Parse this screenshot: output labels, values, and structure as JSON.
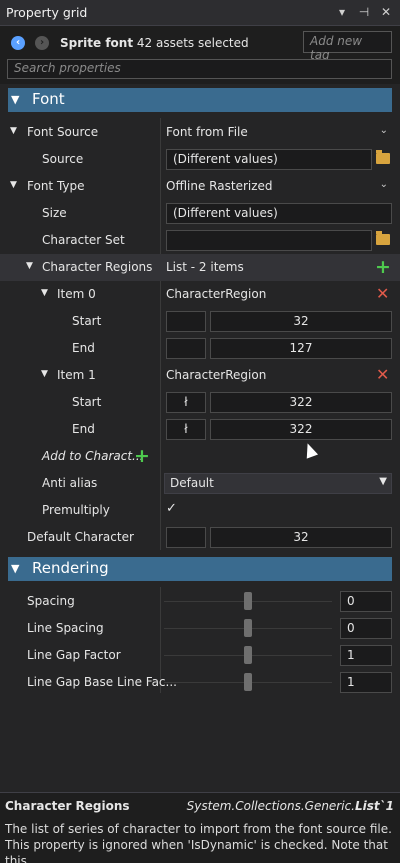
{
  "window": {
    "title": "Property grid",
    "btn_menu": "▾",
    "btn_pin": "⊣",
    "btn_close": "✕"
  },
  "header": {
    "asset_type": "Sprite font",
    "asset_count": "42 assets selected",
    "tag_placeholder": "Add new tag",
    "search_placeholder": "Search properties"
  },
  "categories": {
    "font": "Font",
    "rendering": "Rendering"
  },
  "font": {
    "font_source": {
      "label": "Font Source",
      "value": "Font from File"
    },
    "source": {
      "label": "Source",
      "value": "(Different values)"
    },
    "font_type": {
      "label": "Font Type",
      "value": "Offline Rasterized"
    },
    "size": {
      "label": "Size",
      "value": "(Different values)"
    },
    "character_set": {
      "label": "Character Set",
      "value": ""
    },
    "character_regions": {
      "label": "Character Regions",
      "value": "List - 2 items"
    },
    "items": [
      {
        "label": "Item 0",
        "type": "CharacterRegion",
        "start": {
          "label": "Start",
          "char": "",
          "value": "32"
        },
        "end": {
          "label": "End",
          "char": "",
          "value": "127"
        }
      },
      {
        "label": "Item 1",
        "type": "CharacterRegion",
        "start": {
          "label": "Start",
          "char": "ł",
          "value": "322"
        },
        "end": {
          "label": "End",
          "char": "ł",
          "value": "322"
        }
      }
    ],
    "add_label": "Add to Charact...",
    "anti_alias": {
      "label": "Anti alias",
      "value": "Default"
    },
    "premultiply": {
      "label": "Premultiply",
      "value": "✓"
    },
    "default_character": {
      "label": "Default Character",
      "char": "",
      "value": "32"
    }
  },
  "rendering": {
    "spacing": {
      "label": "Spacing",
      "value": "0",
      "level": 0.5
    },
    "line_spacing": {
      "label": "Line Spacing",
      "value": "0",
      "level": 0.5
    },
    "line_gap_factor": {
      "label": "Line Gap Factor",
      "value": "1",
      "level": 0.5
    },
    "line_gap_base": {
      "label": "Line Gap Base Line Fac...",
      "value": "1",
      "level": 0.5
    }
  },
  "description": {
    "title": "Character Regions",
    "type_prefix": "System.Collections.Generic.",
    "type_name": "List`1",
    "text": "The list of series of character to import from the font source file. This property is ignored when 'IsDynamic' is checked. Note that this..."
  }
}
